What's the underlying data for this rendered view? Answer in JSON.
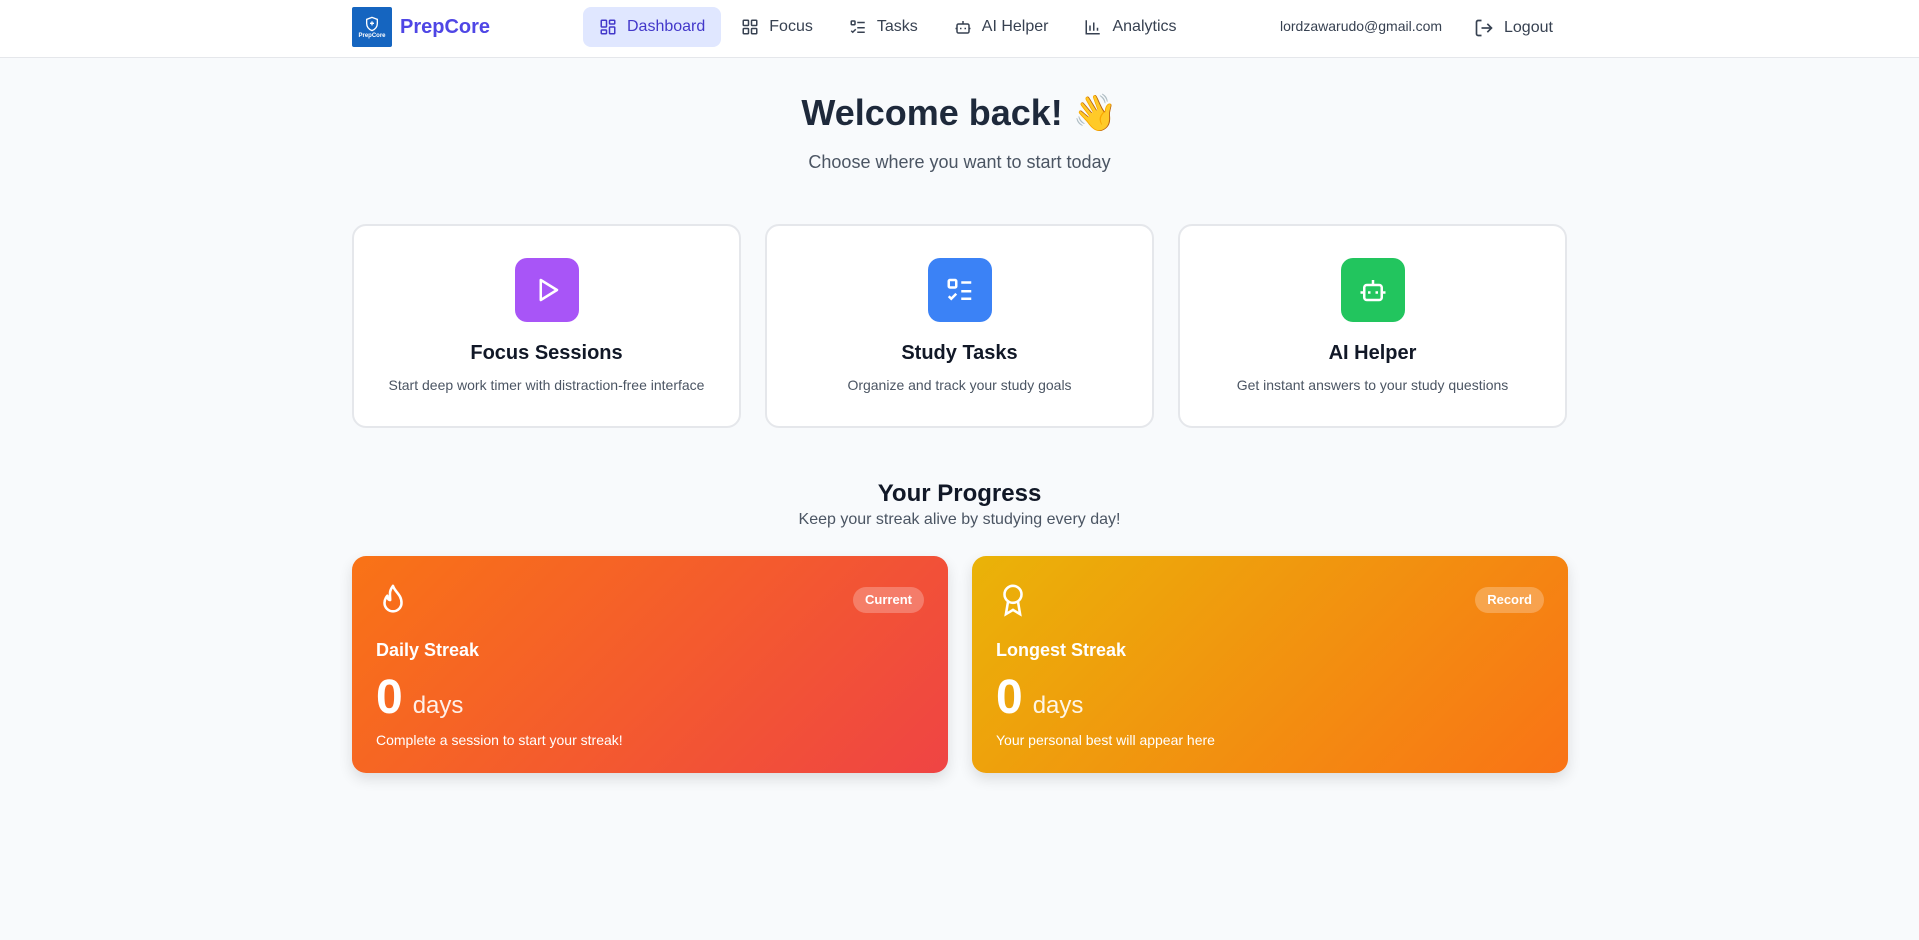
{
  "brand": {
    "name": "PrepCore",
    "logo_text": "PrepCore"
  },
  "nav": {
    "items": [
      {
        "label": "Dashboard",
        "icon": "dashboard-icon",
        "active": true
      },
      {
        "label": "Focus",
        "icon": "focus-icon"
      },
      {
        "label": "Tasks",
        "icon": "tasks-icon"
      },
      {
        "label": "AI Helper",
        "icon": "robot-icon"
      },
      {
        "label": "Analytics",
        "icon": "bar-chart-icon"
      }
    ],
    "user_email": "lordzawarudo@gmail.com",
    "logout_label": "Logout"
  },
  "welcome": {
    "title": "Welcome back! 👋",
    "subtitle": "Choose where you want to start today"
  },
  "cards": [
    {
      "title": "Focus Sessions",
      "desc": "Start deep work timer with distraction-free interface",
      "icon": "play-icon",
      "color": "#a855f7"
    },
    {
      "title": "Study Tasks",
      "desc": "Organize and track your study goals",
      "icon": "checklist-icon",
      "color": "#3b82f6"
    },
    {
      "title": "AI Helper",
      "desc": "Get instant answers to your study questions",
      "icon": "robot-icon",
      "color": "#22c55e"
    }
  ],
  "progress": {
    "title": "Your Progress",
    "subtitle": "Keep your streak alive by studying every day!",
    "streaks": [
      {
        "label": "Daily Streak",
        "badge": "Current",
        "value": "0",
        "unit": "days",
        "note": "Complete a session to start your streak!",
        "icon": "flame-icon"
      },
      {
        "label": "Longest Streak",
        "badge": "Record",
        "value": "0",
        "unit": "days",
        "note": "Your personal best will appear here",
        "icon": "award-icon"
      }
    ]
  },
  "colors": {
    "accent": "#4f46e5",
    "nav_active_bg": "#e0e7ff",
    "daily_gradient": [
      "#f97316",
      "#ef4444"
    ],
    "longest_gradient": [
      "#eab308",
      "#f97316"
    ]
  }
}
